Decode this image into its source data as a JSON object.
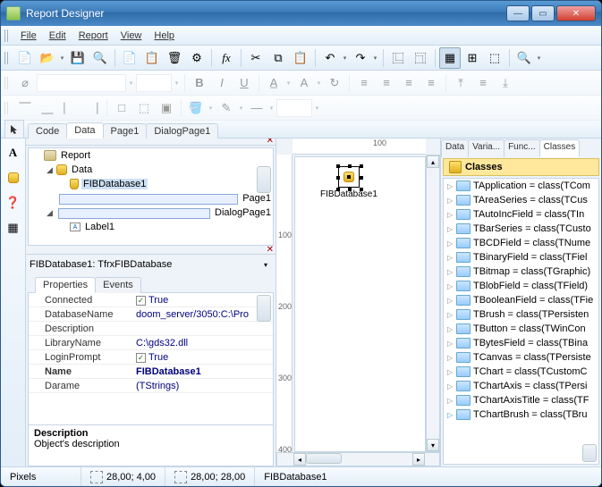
{
  "title": "Report Designer",
  "menus": [
    "File",
    "Edit",
    "Report",
    "View",
    "Help"
  ],
  "tabs": [
    "Code",
    "Data",
    "Page1",
    "DialogPage1"
  ],
  "activeTab": "Data",
  "ruler_h": "100",
  "ruler_v": [
    "100",
    "200",
    "300",
    "400"
  ],
  "tree": {
    "root": "Report",
    "n1": "Data",
    "n2": "FIBDatabase1",
    "n3": "Page1",
    "n4": "DialogPage1",
    "n5": "Label1"
  },
  "objectSelector": "FIBDatabase1: TfrxFIBDatabase",
  "propTabs": [
    "Properties",
    "Events"
  ],
  "props": [
    {
      "k": "Connected",
      "v": "True",
      "chk": true
    },
    {
      "k": "DatabaseName",
      "v": "doom_server/3050:C:\\Pro"
    },
    {
      "k": "Description",
      "v": ""
    },
    {
      "k": "LibraryName",
      "v": "C:\\gds32.dll"
    },
    {
      "k": "LoginPrompt",
      "v": "True",
      "chk": true
    },
    {
      "k": "Name",
      "v": "FIBDatabase1",
      "bold": true
    },
    {
      "k": "Darame",
      "v": "(TStrings)"
    }
  ],
  "descTitle": "Description",
  "descText": "Object's description",
  "canvasComp": "FIBDatabase1",
  "rightTabs": [
    "Data",
    "Varia...",
    "Func...",
    "Classes"
  ],
  "rightActive": "Classes",
  "classesHeader": "Classes",
  "classes": [
    "TApplication = class(TCom",
    "TAreaSeries = class(TCus",
    "TAutoIncField = class(TIn",
    "TBarSeries = class(TCusto",
    "TBCDField = class(TNume",
    "TBinaryField = class(TFiel",
    "TBitmap = class(TGraphic)",
    "TBlobField = class(TField)",
    "TBooleanField = class(TFie",
    "TBrush = class(TPersisten",
    "TButton = class(TWinCon",
    "TBytesField = class(TBina",
    "TCanvas = class(TPersiste",
    "TChart = class(TCustomC",
    "TChartAxis = class(TPersi",
    "TChartAxisTitle = class(TF",
    "TChartBrush = class(TBru"
  ],
  "status": {
    "units": "Pixels",
    "pos": "28,00; 4,00",
    "size": "28,00; 28,00",
    "sel": "FIBDatabase1"
  }
}
